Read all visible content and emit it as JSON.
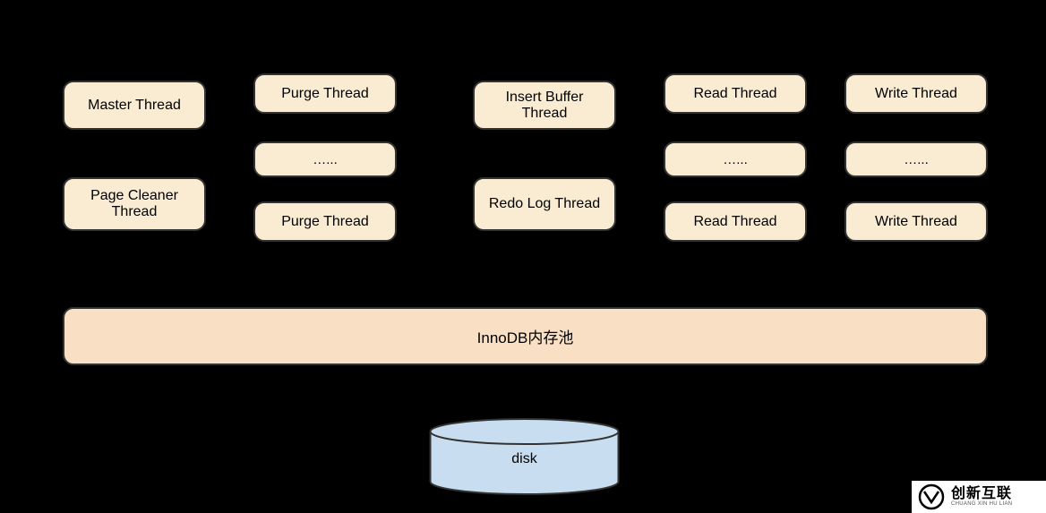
{
  "threads": {
    "col1": {
      "top": "Master Thread",
      "bottom": "Page Cleaner Thread"
    },
    "col2": {
      "top": "Purge Thread",
      "mid": "…...",
      "bottom": "Purge Thread"
    },
    "col3": {
      "top": "Insert Buffer Thread",
      "bottom": "Redo Log Thread"
    },
    "col4": {
      "top": "Read Thread",
      "mid": "…...",
      "bottom": "Read Thread"
    },
    "col5": {
      "top": "Write Thread",
      "mid": "…...",
      "bottom": "Write Thread"
    }
  },
  "memory_pool": "InnoDB内存池",
  "disk": "disk",
  "watermark": {
    "cn": "创新互联",
    "en": "CHUANG XIN HU LIAN"
  },
  "colors": {
    "thread_bg": "#f9ecd3",
    "mem_pool_bg": "#f9dfc4",
    "disk_fill": "#c9ddf0",
    "border": "#333333"
  }
}
